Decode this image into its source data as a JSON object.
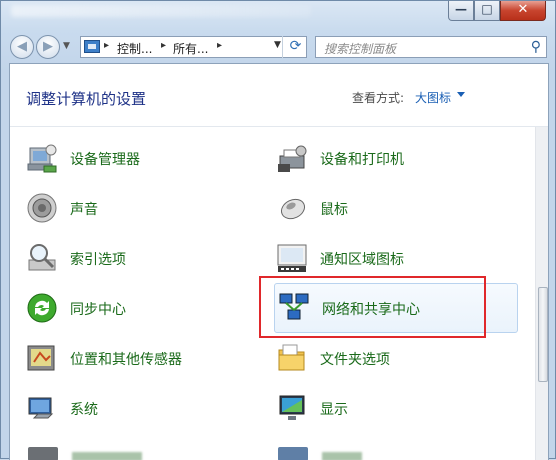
{
  "window": {
    "minimize_glyph": "—",
    "maximize_glyph": "□",
    "close_glyph": "✕"
  },
  "nav": {
    "back_glyph": "◀",
    "forward_glyph": "▶",
    "recent_glyph": "▼",
    "address_segments": [
      "控制...",
      "所有..."
    ],
    "address_separator": "▸",
    "address_dropdown": "▼",
    "refresh_glyph": "⟳",
    "search_placeholder": "搜索控制面板",
    "search_glyph": "⚲"
  },
  "content": {
    "title": "调整计算机的设置",
    "view_by_label": "查看方式:",
    "view_by_value": "大图标"
  },
  "items": [
    {
      "label": "设备管理器",
      "icon": "device-manager-icon"
    },
    {
      "label": "设备和打印机",
      "icon": "devices-printers-icon"
    },
    {
      "label": "声音",
      "icon": "speaker-icon"
    },
    {
      "label": "鼠标",
      "icon": "mouse-icon"
    },
    {
      "label": "索引选项",
      "icon": "index-magnifier-icon"
    },
    {
      "label": "通知区域图标",
      "icon": "notification-area-icon"
    },
    {
      "label": "同步中心",
      "icon": "sync-center-icon"
    },
    {
      "label": "网络和共享中心",
      "icon": "network-sharing-icon"
    },
    {
      "label": "位置和其他传感器",
      "icon": "location-sensor-icon"
    },
    {
      "label": "文件夹选项",
      "icon": "folder-options-icon"
    },
    {
      "label": "系统",
      "icon": "system-computer-icon"
    },
    {
      "label": "显示",
      "icon": "display-monitor-icon"
    }
  ],
  "colors": {
    "link_green": "#1a6a1a",
    "title_blue": "#1e3287",
    "highlight_red": "#e0282b"
  }
}
